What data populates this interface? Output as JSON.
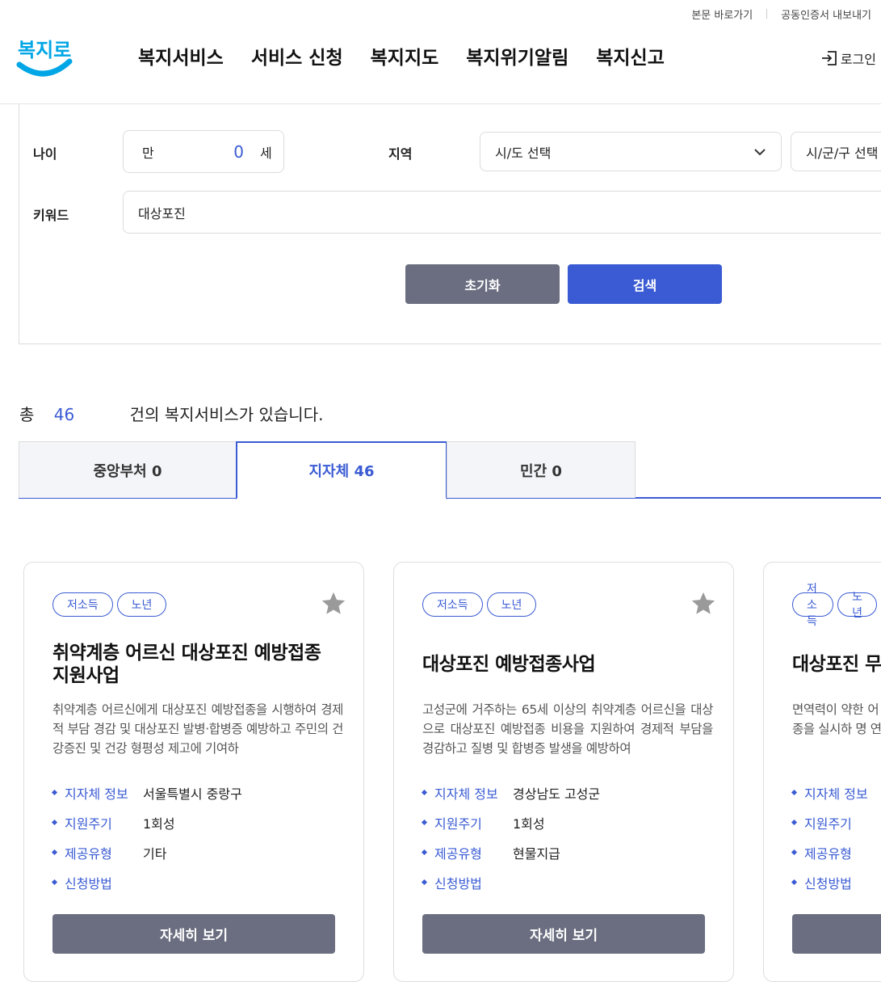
{
  "util": {
    "skip": "본문 바로가기",
    "cert": "공동인증서 내보내기"
  },
  "logo": "복지로",
  "gnb": [
    "복지서비스",
    "서비스 신청",
    "복지지도",
    "복지위기알림",
    "복지신고"
  ],
  "login": "로그인",
  "search": {
    "age_label": "나이",
    "age_prefix": "만",
    "age_value": "0",
    "age_suffix": "세",
    "region_label": "지역",
    "sido": "시/도 선택",
    "sigungu": "시/군/구 선택",
    "keyword_label": "키워드",
    "keyword_value": "대상포진",
    "reset": "초기화",
    "submit": "검색"
  },
  "total": {
    "prefix": "총",
    "count": "46",
    "suffix": "건의 복지서비스가 있습니다."
  },
  "tabs": [
    "중앙부처 0",
    "지자체 46",
    "민간 0"
  ],
  "cards": [
    {
      "tags": [
        "저소득",
        "노년"
      ],
      "title": "취약계층 어르신 대상포진 예방접종 지원사업",
      "desc": "취약계층 어르신에게 대상포진 예방접종을 시행하여 경제적 부담 경감 및 대상포진 발병·합병증 예방하고 주민의 건강증진 및 건강 형평성 제고에 기여하",
      "info": [
        {
          "k": "지자체 정보",
          "v": "서울특별시 중랑구"
        },
        {
          "k": "지원주기",
          "v": "1회성"
        },
        {
          "k": "제공유형",
          "v": "기타"
        },
        {
          "k": "신청방법",
          "v": ""
        }
      ],
      "button": "자세히 보기"
    },
    {
      "tags": [
        "저소득",
        "노년"
      ],
      "title": "대상포진 예방접종사업",
      "desc": "고성군에 거주하는 65세 이상의 취약계층 어르신을 대상으로 대상포진 예방접종 비용을 지원하여 경제적 부담을 경감하고 질병 및 합병증 발생을 예방하여",
      "info": [
        {
          "k": "지자체 정보",
          "v": "경상남도 고성군"
        },
        {
          "k": "지원주기",
          "v": "1회성"
        },
        {
          "k": "제공유형",
          "v": "현물지급"
        },
        {
          "k": "신청방법",
          "v": ""
        }
      ],
      "button": "자세히 보기"
    },
    {
      "tags": [
        "저소득",
        "노년"
      ],
      "title": "대상포진 무",
      "desc": "면역력이 약한 어 방접종을 실시하 명 연장",
      "info": [
        {
          "k": "지자체 정보",
          "v": ""
        },
        {
          "k": "지원주기",
          "v": ""
        },
        {
          "k": "제공유형",
          "v": ""
        },
        {
          "k": "신청방법",
          "v": ""
        }
      ],
      "button": ""
    }
  ],
  "colors": {
    "accent": "#3a5bd3",
    "gray_button": "#6b6e80",
    "logo": "#00a6e6"
  }
}
